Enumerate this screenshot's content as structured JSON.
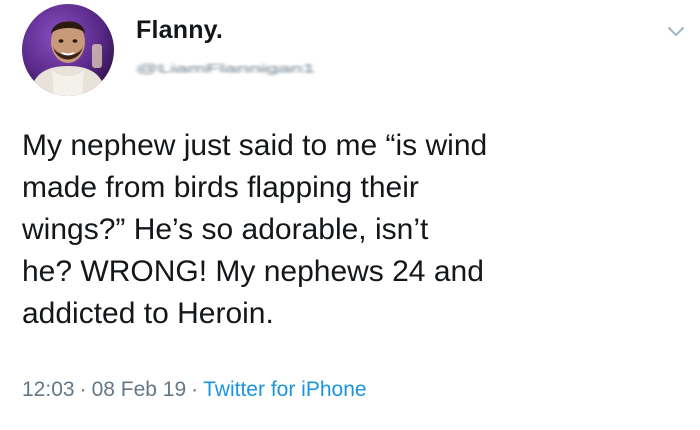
{
  "user": {
    "display_name": "Flanny.",
    "handle": "@LiamFlannigan1"
  },
  "tweet": {
    "lines": [
      "My nephew just said to me “is wind",
      "made from birds flapping their",
      "wings?” He’s so adorable, isn’t",
      "he? WRONG! My nephews 24 and",
      "addicted to Heroin."
    ],
    "time": "12:03",
    "separator": "·",
    "date": "08 Feb 19",
    "source": "Twitter for iPhone"
  },
  "icons": {
    "menu": "chevron-down-icon"
  },
  "colors": {
    "text": "#14171a",
    "secondary": "#657786",
    "link": "#1b95e0",
    "avatar_bg": "#5a2a8a"
  }
}
